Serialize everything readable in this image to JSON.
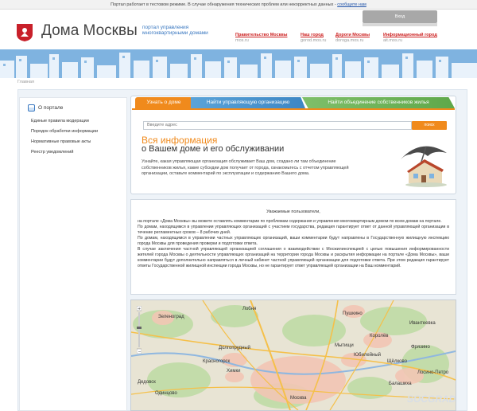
{
  "notice": {
    "text": "Портал работает в тестовом режиме. В случае обнаружения технических проблем или некорректных данных - ",
    "link": "сообщите нам"
  },
  "login": {
    "label": "Вход"
  },
  "logo": {
    "title": "Дома Москвы",
    "subtitle_line1": "портал управления",
    "subtitle_line2": "многоквартирными домами"
  },
  "topnav": [
    {
      "title": "Правительство Москвы",
      "sub": "mos.ru"
    },
    {
      "title": "Наш город",
      "sub": "gorod.mos.ru"
    },
    {
      "title": "Дороги Москвы",
      "sub": "doroga.mos.ru"
    },
    {
      "title": "Информационный город",
      "sub": "ait.mos.ru"
    }
  ],
  "breadcrumb": "Главная",
  "sidebar": {
    "heading": "О портале",
    "items": [
      "Единые правила модерации",
      "Порядок обработки информации",
      "Нормативные правовые акты",
      "Реестр уведомлений"
    ]
  },
  "tabs": [
    "Узнать о доме",
    "Найти управляющую организацию",
    "Найти объединение собственников жилья"
  ],
  "search": {
    "placeholder": "Введите адрес",
    "button": "поиск"
  },
  "info": {
    "title1": "Вся информация",
    "title2": "о Вашем доме и его обслуживании",
    "text": "Узнайте, какая управляющая организация обслуживает Ваш дом, создано ли там объединение собственников жилья, какие субсидии дом получает от города, ознакомьтесь с отчетом управляющей организации, оставьте комментарий по эксплуатации и содержанию Вашего дома."
  },
  "announcement": {
    "heading": "Уважаемые пользователи,",
    "paragraphs": [
      "на портале «Дома Москвы» вы можете оставлять комментарии по проблемам содержания и управления многоквартирным домом по всем домам на портале.",
      "По домам, находящимся в управлении управляющих организаций с участием государства, редакция гарантирует ответ от данной управляющей организации в течение регламентных сроков – 8 рабочих дней.",
      "По домам, находящимся в управлении частных управляющих организаций, ваши комментарии будут направлены в Государственную жилищную инспекцию города Москвы для проведения проверки и подготовки ответа.",
      "В случае заключения частной управляющей организацией соглашения о взаимодействии с Мосжилинспекцией с целью повышения информированности жителей города Москвы о деятельности управляющих организаций на территории города Москвы и раскрытия информации на портале «Дома Москвы», ваши комментарии будут дополнительно направляться в личный кабинет частной управляющей организации для подготовки ответа. При этом редакция гарантирует ответы Государственной жилищной инспекции города Москвы, но не гарантирует ответ управляющей организации на Ваш комментарий."
    ]
  },
  "map": {
    "labels": [
      "Зеленоград",
      "Лобня",
      "Пушкино",
      "Ивантеевка",
      "Королёв",
      "Мытищи",
      "Долгопрудный",
      "Химки",
      "Щёлково",
      "Юбилейный",
      "Фрязино",
      "Балашиха",
      "Лосино-Петро",
      "Одинцово",
      "Красногорск",
      "Дедовск",
      "Москва"
    ]
  },
  "watermark": "SOCGRAD",
  "colors": {
    "accent": "#f08a1c",
    "link_red": "#cc1f1f",
    "blue": "#3a78c0",
    "green": "#5fa84a"
  }
}
